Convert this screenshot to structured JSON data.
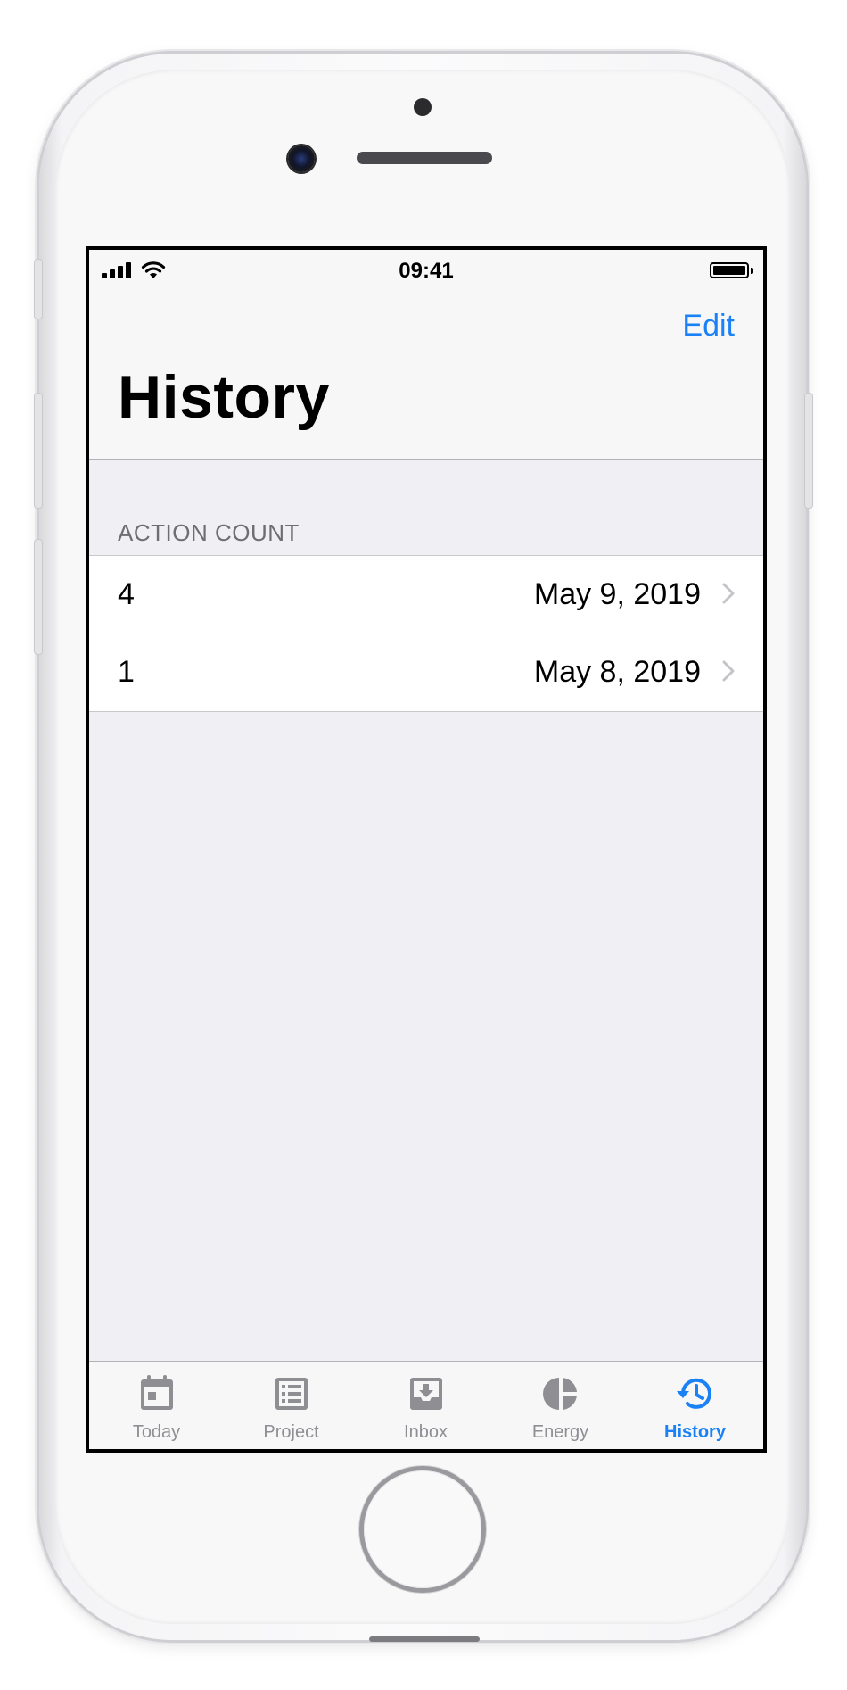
{
  "status_bar": {
    "time": "09:41"
  },
  "nav": {
    "edit_label": "Edit",
    "title": "History"
  },
  "section": {
    "header": "ACTION COUNT"
  },
  "rows": [
    {
      "count": "4",
      "date": "May 9, 2019"
    },
    {
      "count": "1",
      "date": "May 8, 2019"
    }
  ],
  "tabs": [
    {
      "label": "Today",
      "icon": "calendar-icon",
      "active": false
    },
    {
      "label": "Project",
      "icon": "list-icon",
      "active": false
    },
    {
      "label": "Inbox",
      "icon": "inbox-tray-icon",
      "active": false
    },
    {
      "label": "Energy",
      "icon": "pie-chart-icon",
      "active": false
    },
    {
      "label": "History",
      "icon": "history-clock-icon",
      "active": true
    }
  ],
  "colors": {
    "accent": "#1a82f6",
    "inactive": "#8e8e93",
    "background": "#efeff4"
  }
}
